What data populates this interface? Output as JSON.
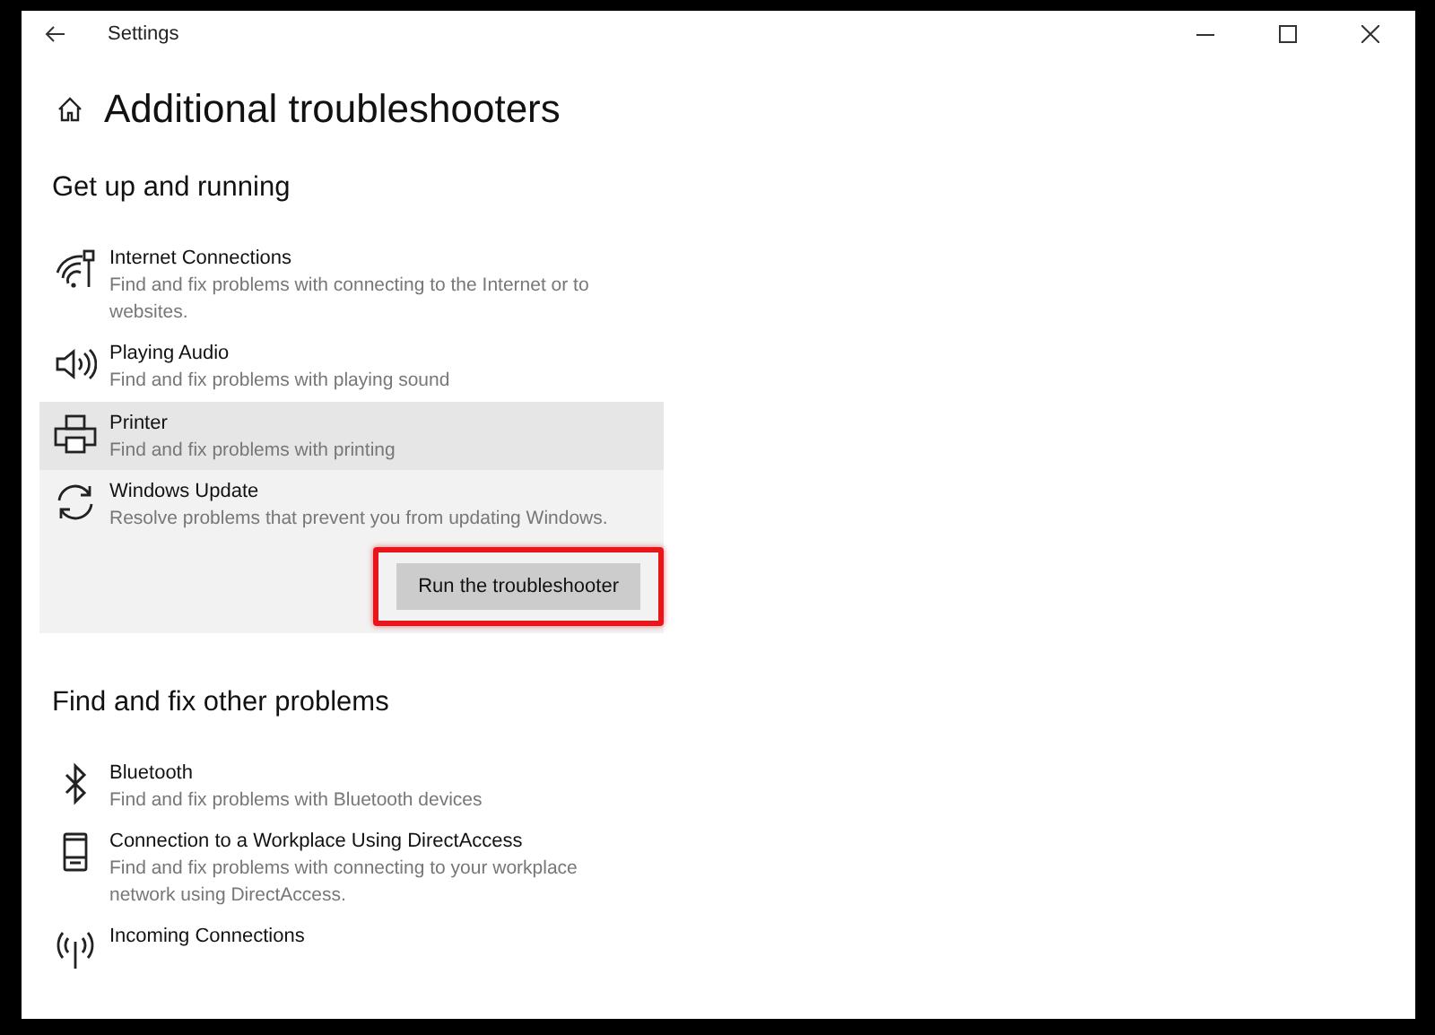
{
  "window": {
    "title": "Settings"
  },
  "page": {
    "title": "Additional troubleshooters"
  },
  "sections": [
    {
      "heading": "Get up and running",
      "items": [
        {
          "kind": "wifi",
          "title": "Internet Connections",
          "description": "Find and fix problems with connecting to the Internet or to websites.",
          "hovered": false,
          "expanded": false
        },
        {
          "kind": "speaker",
          "title": "Playing Audio",
          "description": "Find and fix problems with playing sound",
          "hovered": false,
          "expanded": false
        },
        {
          "kind": "printer",
          "title": "Printer",
          "description": "Find and fix problems with printing",
          "hovered": true,
          "expanded": false
        },
        {
          "kind": "sync",
          "title": "Windows Update",
          "description": "Resolve problems that prevent you from updating Windows.",
          "hovered": false,
          "expanded": true,
          "button": {
            "label": "Run the troubleshooter",
            "highlighted": true
          }
        }
      ]
    },
    {
      "heading": "Find and fix other problems",
      "items": [
        {
          "kind": "bluetooth",
          "title": "Bluetooth",
          "description": "Find and fix problems with Bluetooth devices",
          "hovered": false,
          "expanded": false
        },
        {
          "kind": "phone",
          "title": "Connection to a Workplace Using DirectAccess",
          "description": "Find and fix problems with connecting to your workplace network using DirectAccess.",
          "hovered": false,
          "expanded": false
        },
        {
          "kind": "antenna",
          "title": "Incoming Connections",
          "hovered": false,
          "expanded": false
        }
      ]
    }
  ]
}
